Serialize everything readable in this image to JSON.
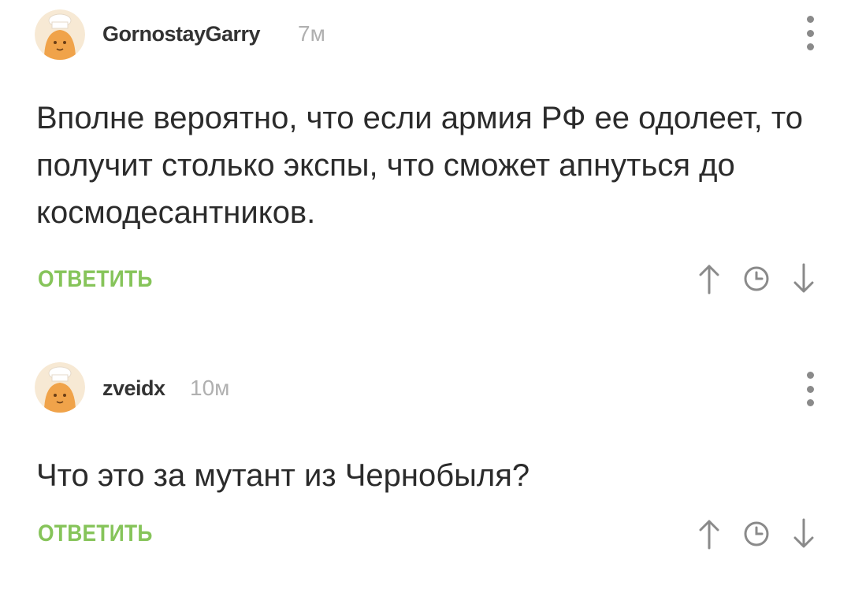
{
  "comments": [
    {
      "author": "GornostayGarry",
      "time": "7м",
      "text": "Вполне вероятно, что если армия РФ ее одолеет, то получит столько экспы, что сможет апнуться до космодесантников.",
      "reply_label": "ОТВЕТИТЬ",
      "avatar_icon": "default-chef-avatar"
    },
    {
      "author": "zveidx",
      "time": "10м",
      "text": "Что это за мутант из Чернобыля?",
      "reply_label": "ОТВЕТИТЬ",
      "avatar_icon": "default-chef-avatar"
    }
  ],
  "icons": {
    "menu": "vertical-dots-icon",
    "up": "arrow-up-icon",
    "clock": "clock-icon",
    "down": "arrow-down-icon"
  },
  "colors": {
    "reply": "#86c45a",
    "time": "#b0b0b0",
    "icons": "#8a8a8a",
    "avatar_bg": "#f7e9d4",
    "avatar_head": "#f0a34a"
  }
}
